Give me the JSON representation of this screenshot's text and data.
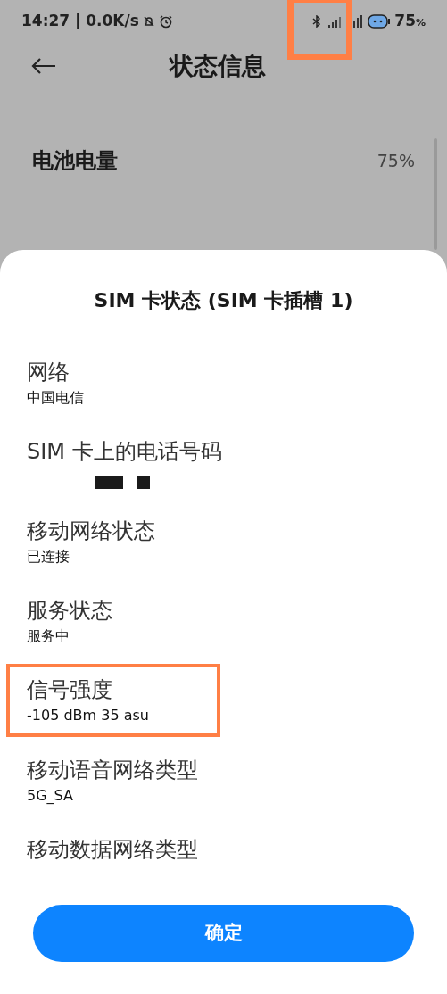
{
  "status_bar": {
    "time": "14:27 | 0.0K/s",
    "battery": "75",
    "battery_unit": "%",
    "signal_highlighted": true
  },
  "header": {
    "title": "状态信息"
  },
  "background_rows": [
    {
      "label": "电池电量",
      "value": "75%"
    }
  ],
  "sheet": {
    "title": "SIM 卡状态 (SIM 卡插槽 1)",
    "items": [
      {
        "kind": "text",
        "label": "网络",
        "value": "中国电信",
        "highlighted": false
      },
      {
        "kind": "redacted",
        "label": "SIM 卡上的电话号码",
        "highlighted": false
      },
      {
        "kind": "text",
        "label": "移动网络状态",
        "value": "已连接",
        "highlighted": false
      },
      {
        "kind": "text",
        "label": "服务状态",
        "value": "服务中",
        "highlighted": false
      },
      {
        "kind": "text",
        "label": "信号强度",
        "value": "-105 dBm 35 asu",
        "highlighted": true
      },
      {
        "kind": "text",
        "label": "移动语音网络类型",
        "value": "5G_SA",
        "highlighted": false
      },
      {
        "kind": "label",
        "label": "移动数据网络类型",
        "highlighted": false
      }
    ],
    "confirm": "确定"
  }
}
